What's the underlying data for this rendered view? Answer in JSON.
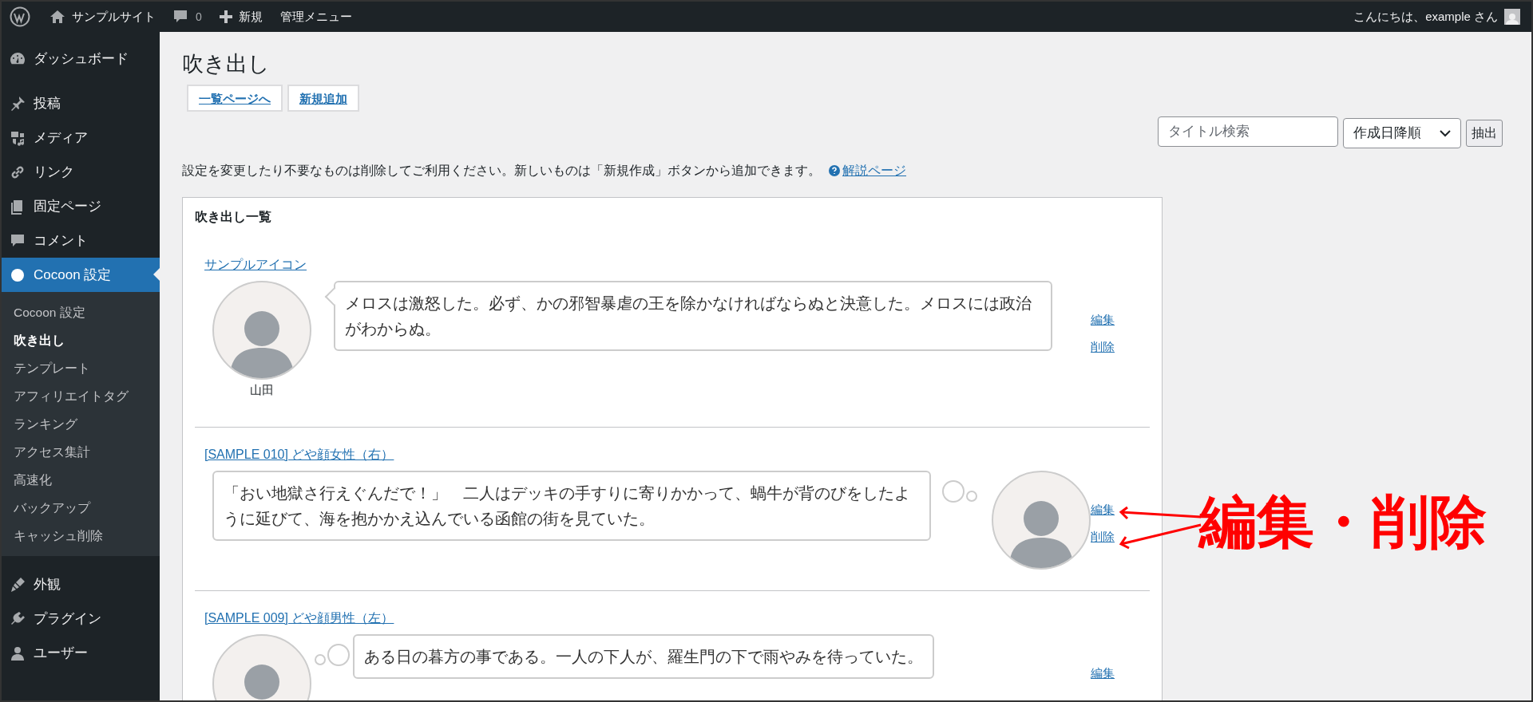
{
  "admin_bar": {
    "site_name": "サンプルサイト",
    "comments": "0",
    "new": "新規",
    "admin_menu": "管理メニュー",
    "greeting": "こんにちは、example さん"
  },
  "sidebar": {
    "items": [
      {
        "label": "ダッシュボード",
        "selected": false
      },
      {
        "label": "投稿",
        "selected": false
      },
      {
        "label": "メディア",
        "selected": false
      },
      {
        "label": "リンク",
        "selected": false
      },
      {
        "label": "固定ページ",
        "selected": false
      },
      {
        "label": "コメント",
        "selected": false
      },
      {
        "label": "Cocoon 設定",
        "selected": true,
        "children": [
          {
            "label": "Cocoon 設定",
            "selected": false
          },
          {
            "label": "吹き出し",
            "selected": true
          },
          {
            "label": "テンプレート",
            "selected": false
          },
          {
            "label": "アフィリエイトタグ",
            "selected": false
          },
          {
            "label": "ランキング",
            "selected": false
          },
          {
            "label": "アクセス集計",
            "selected": false
          },
          {
            "label": "高速化",
            "selected": false
          },
          {
            "label": "バックアップ",
            "selected": false
          },
          {
            "label": "キャッシュ削除",
            "selected": false
          }
        ]
      },
      {
        "label": "外観",
        "selected": false
      },
      {
        "label": "プラグイン",
        "selected": false
      },
      {
        "label": "ユーザー",
        "selected": false
      }
    ]
  },
  "page": {
    "title": "吹き出し",
    "buttons": [
      "一覧ページへ",
      "新規追加"
    ],
    "search": {
      "placeholder": "タイトル検索"
    },
    "sort": {
      "value": "作成日降順"
    },
    "filter_button": "抽出",
    "description": "設定を変更したり不要なものは削除してご利用ください。新しいものは「新規作成」ボタンから追加できます。",
    "help_link": "解説ページ"
  },
  "list": {
    "title": "吹き出し一覧",
    "entries": [
      {
        "title": "サンプルアイコン",
        "name": "山田",
        "text": "メロスは激怒した。必ず、かの邪智暴虐の王を除かなければならぬと決意した。メロスには政治がわからぬ。",
        "kind": "left_speech",
        "actions": [
          "編集",
          "削除"
        ]
      },
      {
        "title": "[SAMPLE 010] どや顔女性（右）",
        "text": "「おい地獄さ行えぐんだで！」　二人はデッキの手すりに寄りかかって、蝸牛が背のびをしたように延びて、海を抱かかえ込んでいる函館の街を見ていた。",
        "kind": "right_thought",
        "actions": [
          "編集",
          "削除"
        ]
      },
      {
        "title": "[SAMPLE 009] どや顔男性（左）",
        "text": "ある日の暮方の事である。一人の下人が、羅生門の下で雨やみを待っていた。",
        "kind": "left_thought",
        "actions": [
          "編集"
        ]
      }
    ]
  },
  "annotation": {
    "text": "編集・削除"
  }
}
